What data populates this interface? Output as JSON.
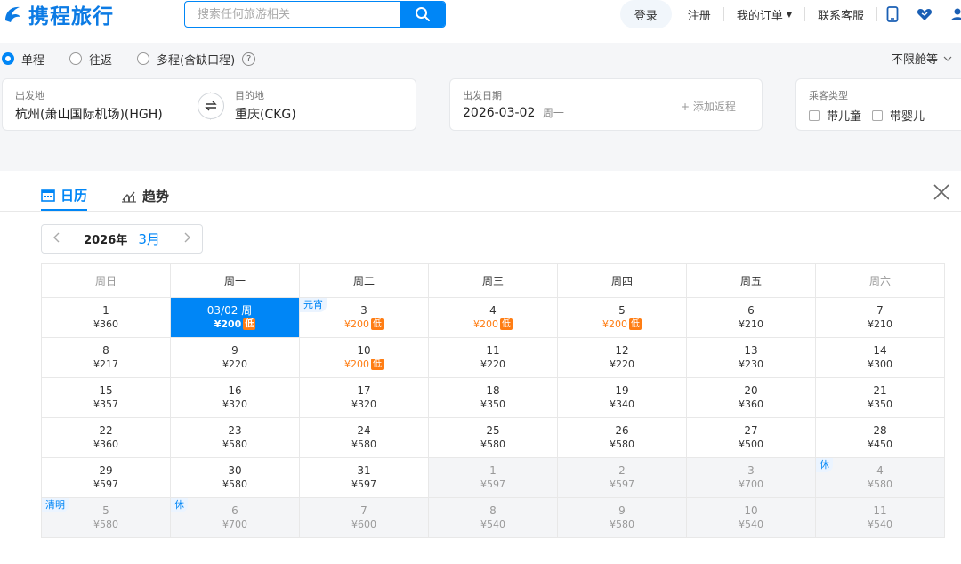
{
  "header": {
    "logo_text": "携程旅行",
    "search_placeholder": "搜索任何旅游相关",
    "nav": {
      "login": "登录",
      "register": "注册",
      "orders": "我的订单",
      "service": "联系客服"
    },
    "brand_color": "#0086f6"
  },
  "trip_type": {
    "options": [
      "单程",
      "往返",
      "多程(含缺口程)"
    ],
    "selected": "单程",
    "cabin": "不限舱等"
  },
  "search": {
    "from_label": "出发地",
    "from_value": "杭州(萧山国际机场)(HGH)",
    "to_label": "目的地",
    "to_value": "重庆(CKG)",
    "date_label": "出发日期",
    "date_value": "2026-03-02",
    "date_weekday": "周一",
    "add_return": "+ 添加返程",
    "passenger_label": "乘客类型",
    "passenger_opts": [
      "带儿童",
      "带婴儿"
    ]
  },
  "calendar": {
    "tabs": [
      "日历",
      "趋势"
    ],
    "year": "2026年",
    "month": "3月",
    "weekdays": [
      "周日",
      "周一",
      "周二",
      "周三",
      "周四",
      "周五",
      "周六"
    ],
    "low_label": "低",
    "weeks": [
      [
        {
          "d": "1",
          "p": "¥360"
        },
        {
          "d": "03/02 周一",
          "p": "¥200",
          "low": true,
          "sel": true
        },
        {
          "d": "3",
          "p": "¥200",
          "low": true,
          "tag": "元宵"
        },
        {
          "d": "4",
          "p": "¥200",
          "low": true
        },
        {
          "d": "5",
          "p": "¥200",
          "low": true
        },
        {
          "d": "6",
          "p": "¥210"
        },
        {
          "d": "7",
          "p": "¥210"
        }
      ],
      [
        {
          "d": "8",
          "p": "¥217"
        },
        {
          "d": "9",
          "p": "¥220"
        },
        {
          "d": "10",
          "p": "¥200",
          "low": true
        },
        {
          "d": "11",
          "p": "¥220"
        },
        {
          "d": "12",
          "p": "¥220"
        },
        {
          "d": "13",
          "p": "¥230"
        },
        {
          "d": "14",
          "p": "¥300"
        }
      ],
      [
        {
          "d": "15",
          "p": "¥357"
        },
        {
          "d": "16",
          "p": "¥320"
        },
        {
          "d": "17",
          "p": "¥320"
        },
        {
          "d": "18",
          "p": "¥350"
        },
        {
          "d": "19",
          "p": "¥340"
        },
        {
          "d": "20",
          "p": "¥360"
        },
        {
          "d": "21",
          "p": "¥350"
        }
      ],
      [
        {
          "d": "22",
          "p": "¥360"
        },
        {
          "d": "23",
          "p": "¥580"
        },
        {
          "d": "24",
          "p": "¥580"
        },
        {
          "d": "25",
          "p": "¥580"
        },
        {
          "d": "26",
          "p": "¥580"
        },
        {
          "d": "27",
          "p": "¥500"
        },
        {
          "d": "28",
          "p": "¥450"
        }
      ],
      [
        {
          "d": "29",
          "p": "¥597"
        },
        {
          "d": "30",
          "p": "¥580"
        },
        {
          "d": "31",
          "p": "¥597"
        },
        {
          "d": "1",
          "p": "¥597",
          "next": true
        },
        {
          "d": "2",
          "p": "¥597",
          "next": true
        },
        {
          "d": "3",
          "p": "¥700",
          "next": true
        },
        {
          "d": "4",
          "p": "¥580",
          "next": true,
          "tag": "休"
        }
      ],
      [
        {
          "d": "5",
          "p": "¥580",
          "next": true,
          "tag": "清明"
        },
        {
          "d": "6",
          "p": "¥700",
          "next": true,
          "tag": "休"
        },
        {
          "d": "7",
          "p": "¥600",
          "next": true
        },
        {
          "d": "8",
          "p": "¥540",
          "next": true
        },
        {
          "d": "9",
          "p": "¥580",
          "next": true
        },
        {
          "d": "10",
          "p": "¥540",
          "next": true
        },
        {
          "d": "11",
          "p": "¥540",
          "next": true
        }
      ]
    ]
  }
}
